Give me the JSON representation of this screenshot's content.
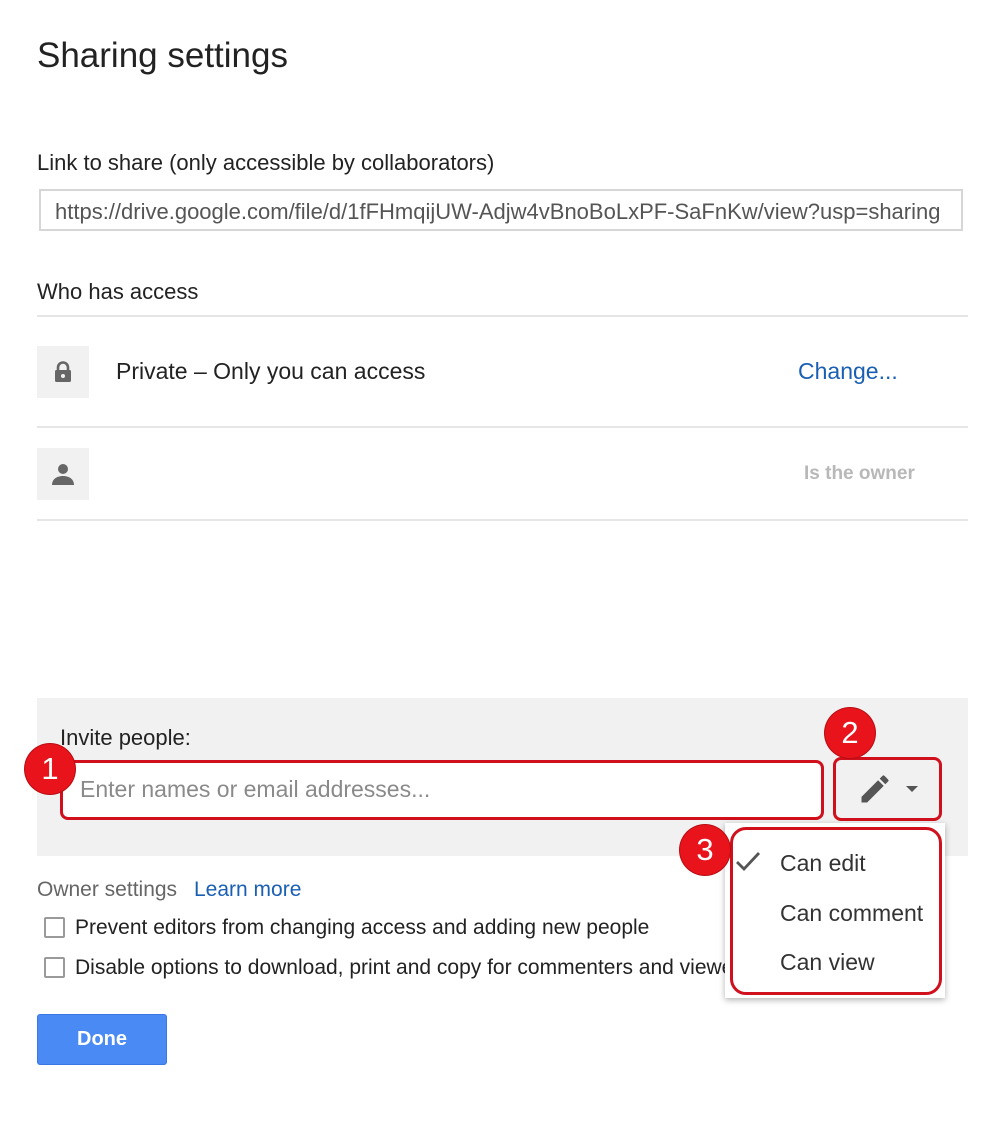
{
  "dialog": {
    "title": "Sharing settings"
  },
  "link_section": {
    "label": "Link to share (only accessible by collaborators)",
    "url": "https://drive.google.com/file/d/1fFHmqijUW-Adjw4vBnoBoLxPF-SaFnKw/view?usp=sharing"
  },
  "access_section": {
    "label": "Who has access",
    "rows": [
      {
        "icon": "lock-icon",
        "text": "Private – Only you can access",
        "action": "Change..."
      },
      {
        "icon": "person-icon",
        "role": "Is the owner"
      }
    ]
  },
  "invite": {
    "label": "Invite people:",
    "placeholder": "Enter names or email addresses...",
    "permission_icon": "pencil-icon"
  },
  "permission_menu": {
    "items": [
      {
        "label": "Can edit",
        "checked": true
      },
      {
        "label": "Can comment",
        "checked": false
      },
      {
        "label": "Can view",
        "checked": false
      }
    ]
  },
  "owner_settings": {
    "label": "Owner settings",
    "learn_more": "Learn more",
    "options": [
      {
        "label": "Prevent editors from changing access and adding new people",
        "checked": false
      },
      {
        "label": "Disable options to download, print and copy for commenters and viewers",
        "checked": false
      }
    ]
  },
  "done_button": {
    "label": "Done"
  },
  "callouts": [
    "1",
    "2",
    "3"
  ],
  "colors": {
    "callout_red": "#e8131b",
    "link_blue": "#1a5fb4",
    "primary_button": "#4a8af4"
  }
}
